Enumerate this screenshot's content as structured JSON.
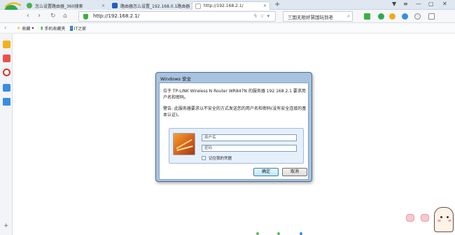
{
  "tabs": [
    {
      "title": "怎么设置路由器_360搜索",
      "active": false
    },
    {
      "title": "路由器怎么设置_192.168.0.1路由器",
      "active": false
    },
    {
      "title": "http://192.168.2.1/",
      "active": true
    }
  ],
  "address": {
    "url": "http://192.168.2.1/",
    "search_text": "三国无限好慧国玩到老"
  },
  "bookmarks": [
    {
      "label": "收藏",
      "icon": "star-icon"
    },
    {
      "label": "手机收藏夹",
      "icon": "phone-icon"
    },
    {
      "label": "IT之家"
    }
  ],
  "dialog": {
    "title": "Windows 安全",
    "message1": "位于 TP-LINK Wireless N Router WR847N 的服务器 192.168.2.1 要求用户名和密码。",
    "message2": "警告: 此服务器要求以不安全的方式发送您的用户名和密码(没有安全连接的基本认证)。",
    "username_placeholder": "用户名",
    "password_placeholder": "密码",
    "remember_label": "记住我的凭据",
    "ok_label": "确定",
    "cancel_label": "取消"
  },
  "colors": {
    "dialog_frame": "#a9c3df",
    "secure_shield": "#3cb044",
    "browser_logo": "#2fa84f"
  }
}
